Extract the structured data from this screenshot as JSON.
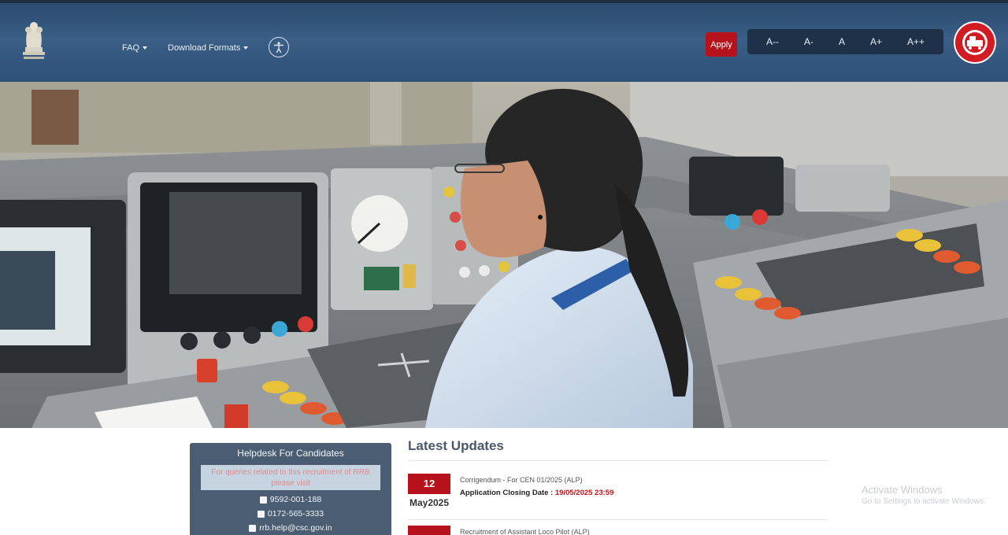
{
  "header": {
    "nav": [
      {
        "label": "FAQ"
      },
      {
        "label": "Download Formats"
      }
    ],
    "apply_label": "Apply",
    "font_sizes": [
      "A--",
      "A-",
      "A",
      "A+",
      "A++"
    ]
  },
  "helpdesk": {
    "title": "Helpdesk For Candidates",
    "note": "For queries related to this recruitment of RRB please visit",
    "phone1": "9592-001-188",
    "phone2": "0172-565-3333",
    "email": "rrb.help@csc.gov.in"
  },
  "updates": {
    "title": "Latest Updates",
    "items": [
      {
        "day": "12",
        "month": "May2025",
        "text": "Corrigendum - For CEN 01/2025 (ALP)",
        "closing_label": "Application Closing Date :",
        "closing_date": "19/05/2025 23:59"
      },
      {
        "text": "Recruitment of Assistant Loco Pilot (ALP)"
      }
    ]
  },
  "watermark": {
    "line1": "Activate Windows",
    "line2": "Go to Settings to activate Windows."
  },
  "colors": {
    "header": "#2f5077",
    "apply": "#b5121b",
    "helpdesk": "#4a5d72"
  }
}
